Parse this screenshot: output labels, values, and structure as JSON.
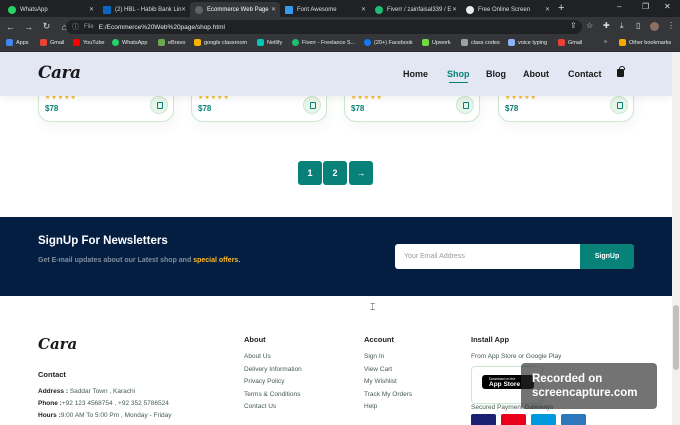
{
  "browser": {
    "tabs": [
      {
        "title": "WhatsApp",
        "color": "#25d366",
        "active": false
      },
      {
        "title": "(2) HBL - Habib Bank Lin",
        "color": "#0a66c2",
        "active": false
      },
      {
        "title": "Ecommerce Web Page",
        "color": "#5f6368",
        "active": true
      },
      {
        "title": "Font Awesome",
        "color": "#339af0",
        "active": false
      },
      {
        "title": "Fiverr / zainfaisal339 / E",
        "color": "#1dbf73",
        "active": false
      },
      {
        "title": "Free Online Screen",
        "color": "#e8eaed",
        "active": false
      }
    ],
    "new_tab_symbol": "+",
    "window_controls": {
      "minimize": "–",
      "maximize": "❐",
      "close": "✕"
    },
    "nav": {
      "back": "←",
      "forward": "→",
      "reload": "↻",
      "home": "⌂"
    },
    "address": {
      "scheme": "File",
      "url": "E:/Ecommerce%20Web%20page/shop.html"
    },
    "bookmarks": [
      {
        "label": "Apps",
        "color": "#4285f4"
      },
      {
        "label": "Gmail",
        "color": "#ea4335"
      },
      {
        "label": "YouTube",
        "color": "#ff0000"
      },
      {
        "label": "WhatsApp",
        "color": "#25d366"
      },
      {
        "label": "eBravo",
        "color": "#6aa84f"
      },
      {
        "label": "google classroom",
        "color": "#f4b400"
      },
      {
        "label": "Netlify",
        "color": "#00c7b7"
      },
      {
        "label": "Fiverr - Freelance S...",
        "color": "#1dbf73"
      },
      {
        "label": "(20+) Facebook",
        "color": "#1877f2"
      },
      {
        "label": "Upwork",
        "color": "#6fda44"
      },
      {
        "label": "class codes",
        "color": "#9aa0a6"
      },
      {
        "label": "voice typing",
        "color": "#8ab4f8"
      },
      {
        "label": "Gmail",
        "color": "#ea4335"
      },
      {
        "label": "Other bookmarks",
        "color": "#f9ab00"
      }
    ]
  },
  "site": {
    "logo": "Cara",
    "nav": [
      "Home",
      "Shop",
      "Blog",
      "About",
      "Contact"
    ],
    "active_nav": "Shop",
    "products": [
      {
        "price": "$78",
        "rating": 5
      },
      {
        "price": "$78",
        "rating": 5
      },
      {
        "price": "$78",
        "rating": 5
      },
      {
        "price": "$78",
        "rating": 5
      }
    ],
    "pagination": [
      "1",
      "2",
      "→"
    ],
    "newsletter": {
      "title": "SignUp For Newsletters",
      "subtitle_prefix": "Get E-mail updates about our Latest shop and ",
      "subtitle_highlight": "special offers.",
      "placeholder": "Your Email Address",
      "button": "SignUp"
    },
    "footer": {
      "logo": "Cara",
      "contact": {
        "heading": "Contact",
        "address_label": "Address :",
        "address": " Saddar Town , Karachi",
        "phone_label": "Phone :",
        "phone": "+92 123 4568754 , +92 352 5786524",
        "hours_label": "Hours :",
        "hours": "9:00 AM To 5:00 Pm , Monday - Friday"
      },
      "about": {
        "heading": "About",
        "links": [
          "About Us",
          "Delivery Information",
          "Privacy Policy",
          "Terms & Conditions",
          "Contact Us"
        ]
      },
      "account": {
        "heading": "Account",
        "links": [
          "Sign In",
          "View Cart",
          "My Wishlist",
          "Track My Orders",
          "Help"
        ]
      },
      "install": {
        "heading": "Install App",
        "desc": "From App Store or Google Play",
        "store_small": "Download on the",
        "store_big": "App Store",
        "secured": "Secured Payment Gateways",
        "payments": [
          {
            "name": "visa-icon",
            "color": "#1a1f71"
          },
          {
            "name": "mastercard-icon",
            "color": "#eb001b"
          },
          {
            "name": "maestro-icon",
            "color": "#0099df"
          },
          {
            "name": "amex-icon",
            "color": "#2e77bc"
          }
        ]
      }
    }
  },
  "watermark": {
    "line1": "Recorded on",
    "line2": "screencapture.com"
  }
}
